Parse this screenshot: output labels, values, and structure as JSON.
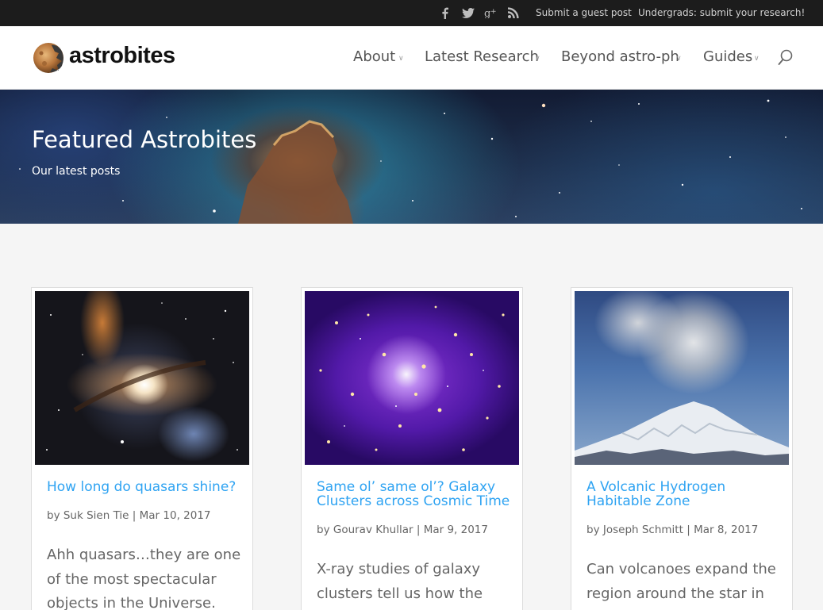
{
  "topbar": {
    "social_icons": [
      "facebook-icon",
      "twitter-icon",
      "google-plus-icon",
      "rss-icon"
    ],
    "links": [
      "Submit a guest post",
      "Undergrads: submit your research!"
    ]
  },
  "header": {
    "logo_text": "astrobites",
    "nav": [
      {
        "label": "About"
      },
      {
        "label": "Latest Research"
      },
      {
        "label": "Beyond astro-ph"
      },
      {
        "label": "Guides"
      }
    ],
    "search_icon": "search-icon"
  },
  "hero": {
    "title": "Featured Astrobites",
    "subtitle": "Our latest posts"
  },
  "posts": [
    {
      "title": "How long do quasars shine?",
      "author": "Suk Sien Tie",
      "date": "Mar 10, 2017",
      "excerpt": "Ahh quasars…they are one of the most spectacular objects in the Universe. But"
    },
    {
      "title": "Same ol’ same ol’? Galaxy Clusters across Cosmic Time",
      "author": "Gourav Khullar",
      "date": "Mar 9, 2017",
      "excerpt": "X-ray studies of galaxy clusters tell us how the"
    },
    {
      "title": "A Volcanic Hydrogen Habitable Zone",
      "author": "Joseph Schmitt",
      "date": "Mar 8, 2017",
      "excerpt": "Can volcanoes expand the region around the star in"
    }
  ],
  "meta": {
    "by": "by",
    "separator": "|"
  },
  "colors": {
    "link": "#2ea3f2",
    "topbar": "#1c1c1c",
    "page_bg": "#f5f5f5"
  }
}
